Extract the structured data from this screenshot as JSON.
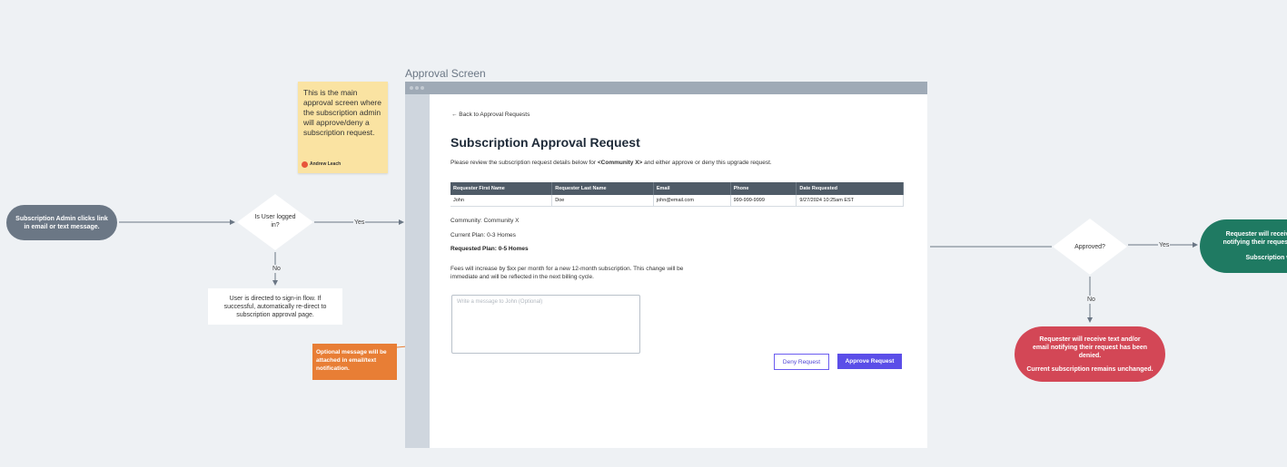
{
  "start_node": "Subscription Admin clicks link in email or text message.",
  "decision_logged_in": "Is User logged in?",
  "edge_yes_1": "Yes",
  "edge_no_1": "No",
  "signin_box": "User is directed to sign-in flow. If successful, automatically re-direct to subscription approval page.",
  "sticky_note": {
    "text": "This is the main approval screen where the subscription admin will approve/deny a subscription request.",
    "author": "Andrew Leach"
  },
  "optional_note": "Optional message will be attached in email/text notification.",
  "screen": {
    "title": "Approval Screen",
    "back_link": "← Back to Approval Requests",
    "page_title": "Subscription Approval Request",
    "intro_prefix": "Please review the subscription request details below for ",
    "intro_community": "<Community X>",
    "intro_suffix": " and either approve or deny this upgrade request.",
    "table": {
      "headers": [
        "Requester First Name",
        "Requester Last Name",
        "Email",
        "Phone",
        "Date Requested"
      ],
      "row": [
        "John",
        "Doe",
        "john@email.com",
        "999-999-9999",
        "9/27/2024 10:25am EST"
      ]
    },
    "community": "Community: Community X",
    "current_plan": "Current Plan: 0-3 Homes",
    "requested_plan": "Requested Plan: 0-5 Homes",
    "fees": "Fees will increase by $xx per month for a new 12-month subscription. This change will be immediate and will be reflected in the next billing cycle.",
    "message_placeholder": "Write a message to John (Optional)",
    "deny_label": "Deny Request",
    "approve_label": "Approve Request"
  },
  "decision_approved": "Approved?",
  "edge_yes_2": "Yes",
  "edge_no_2": "No",
  "approved_node": {
    "line1": "Requester will receive t",
    "line2": "notifying their request ha",
    "line3": "Subscription wil"
  },
  "denied_node": {
    "line1": "Requester will receive text and/or email notifying their request has been denied.",
    "line2": "Current subscription remains unchanged."
  },
  "colors": {
    "start": "#6b7785",
    "approved": "#1f7a62",
    "denied": "#d34756",
    "sticky": "#fae3a2",
    "optional": "#e87e35",
    "accent": "#5b4ee8"
  }
}
